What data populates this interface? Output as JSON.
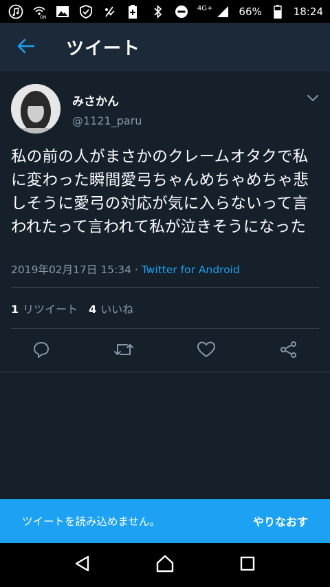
{
  "status_bar": {
    "network": "4G+",
    "battery_percent": "66%",
    "time": "18:24",
    "icons_left": [
      "music-icon",
      "wifi-calling-icon",
      "image-icon",
      "shield-icon",
      "signal-booster-icon",
      "battery-plus-icon"
    ],
    "icons_right": [
      "bluetooth-icon",
      "do-not-disturb-icon",
      "cell-signal-icon",
      "battery-icon"
    ]
  },
  "app_bar": {
    "title": "ツイート",
    "back_icon": "arrow-left-icon"
  },
  "tweet": {
    "display_name": "みさかん",
    "handle": "@1121_paru",
    "text": "私の前の人がまさかのクレームオタクで私に変わった瞬間愛弓ちゃんめちゃめちゃ悲しそうに愛弓の対応が気に入らないって言われたって言われて私が泣きそうになった",
    "timestamp": "2019年02月17日 15:34 · ",
    "source": "Twitter for Android",
    "retweet_count": "1",
    "retweet_label": "リツイート",
    "like_count": "4",
    "like_label": "いいね"
  },
  "actions": [
    "reply-icon",
    "retweet-icon",
    "like-icon",
    "share-icon"
  ],
  "toast": {
    "message": "ツイートを読み込めません。",
    "action": "やりなおす"
  },
  "nav": [
    "back-triangle-icon",
    "home-circle-icon",
    "recents-square-icon"
  ],
  "colors": {
    "background": "#15202b",
    "app_bar": "#1c2938",
    "accent": "#1da1f2",
    "secondary_text": "#8899a6",
    "divider": "#38444d"
  }
}
